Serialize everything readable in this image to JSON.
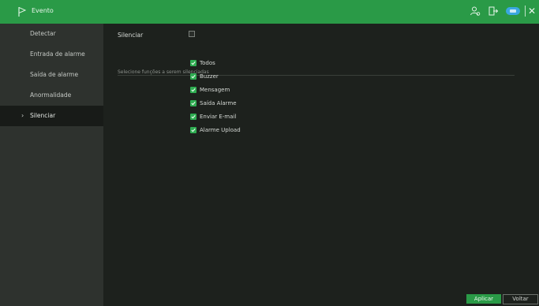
{
  "titlebar": {
    "title": "Evento",
    "icons": [
      "flag-icon",
      "user-icon",
      "logout-icon",
      "cloud-icon",
      "close-icon"
    ],
    "accent": "#2a9a47"
  },
  "sidebar": {
    "items": [
      {
        "label": "Detectar",
        "active": false
      },
      {
        "label": "Entrada de alarme",
        "active": false
      },
      {
        "label": "Saída de alarme",
        "active": false
      },
      {
        "label": "Anormalidade",
        "active": false
      },
      {
        "label": "Silenciar",
        "active": true
      }
    ]
  },
  "main": {
    "silenciar_label": "Silenciar",
    "silenciar_checked": false,
    "section_label": "Selecione funções a serem silenciadas",
    "options": [
      {
        "label": "Todos",
        "checked": true
      },
      {
        "label": "Buzzer",
        "checked": true
      },
      {
        "label": "Mensagem",
        "checked": true
      },
      {
        "label": "Saída Alarme",
        "checked": true
      },
      {
        "label": "Enviar E-mail",
        "checked": true
      },
      {
        "label": "Alarme Upload",
        "checked": true
      }
    ]
  },
  "buttons": {
    "apply": "Aplicar",
    "back": "Voltar"
  }
}
